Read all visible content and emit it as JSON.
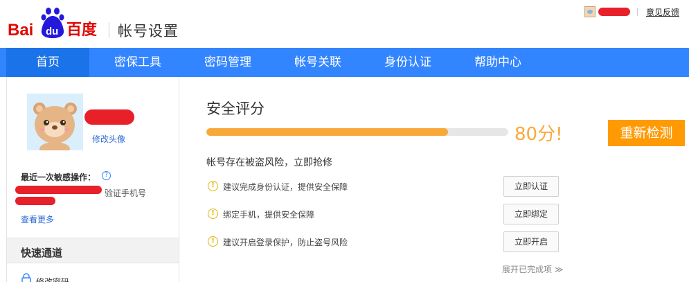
{
  "header": {
    "logo_text": "Bai du 百度",
    "page_title": "帐号设置",
    "feedback_link": "意见反馈"
  },
  "nav": {
    "items": [
      {
        "label": "首页",
        "active": true
      },
      {
        "label": "密保工具",
        "active": false
      },
      {
        "label": "密码管理",
        "active": false
      },
      {
        "label": "帐号关联",
        "active": false
      },
      {
        "label": "身份认证",
        "active": false
      },
      {
        "label": "帮助中心",
        "active": false
      }
    ]
  },
  "sidebar": {
    "change_avatar": "修改头像",
    "sensitive_label": "最近一次敏感操作：",
    "sensitive_op": "验证手机号",
    "see_more": "查看更多",
    "quick_title": "快速通道",
    "quick_items": [
      {
        "label": "修改密码",
        "icon": "lock-icon"
      }
    ]
  },
  "security": {
    "title": "安全评分",
    "score_text": "80分!",
    "score_percent": 80,
    "recheck_button": "重新检测",
    "risk_text": "帐号存在被盗风险，立即抢修",
    "items": [
      {
        "text": "建议完成身份认证，提供安全保障",
        "button": "立即认证"
      },
      {
        "text": "绑定手机，提供安全保障",
        "button": "立即绑定"
      },
      {
        "text": "建议开启登录保护，防止盗号风险",
        "button": "立即开启"
      }
    ],
    "expand_link": "展开已完成项 ≫"
  },
  "colors": {
    "nav_bg": "#3385ff",
    "nav_active": "#1a73e8",
    "score_orange": "#f9a93a",
    "button_orange": "#ff9a05",
    "link_blue": "#2b6bd6",
    "warning_yellow": "#e2b200",
    "logo_red": "#e10602",
    "logo_blue": "#2319dc"
  }
}
